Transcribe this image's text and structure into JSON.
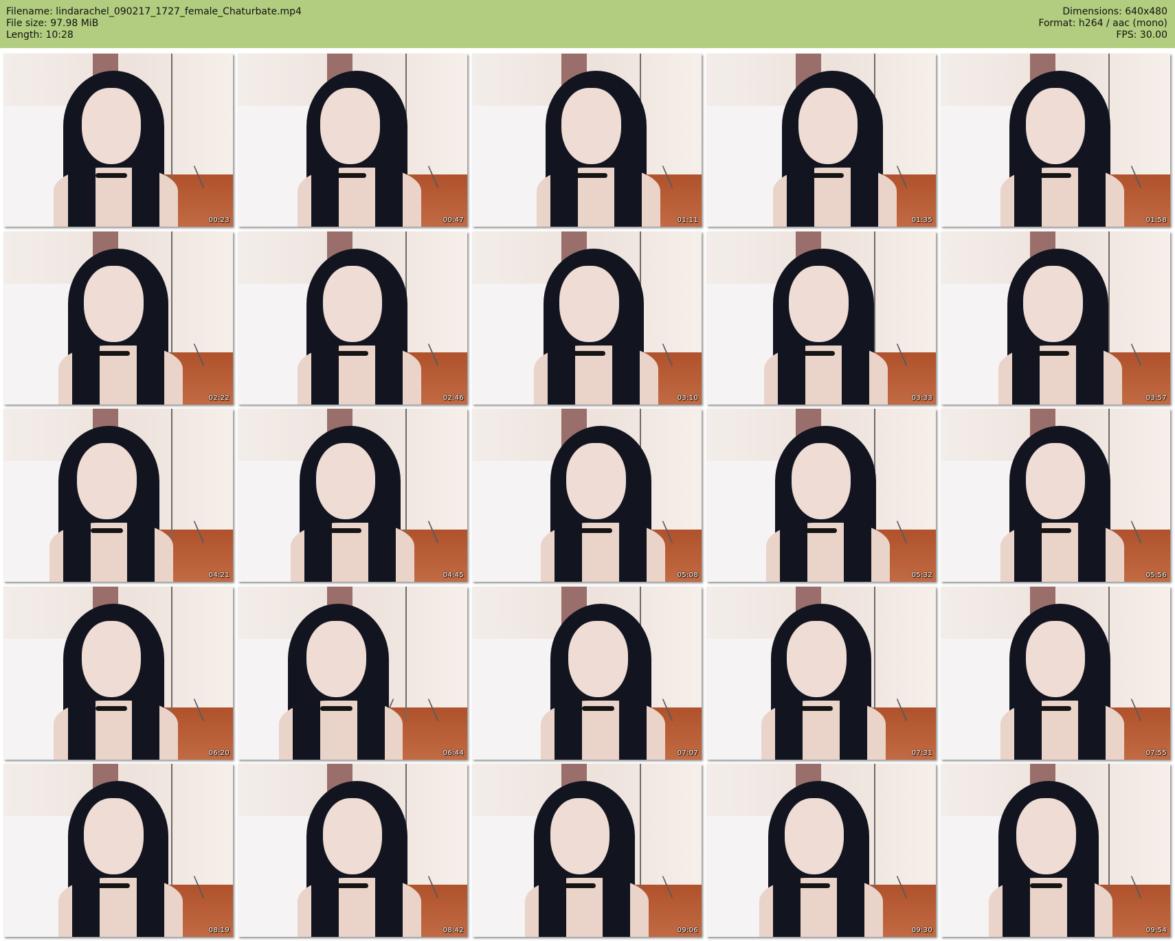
{
  "header": {
    "filename": "Filename: lindarachel_090217_1727_female_Chaturbate.mp4",
    "file_size": "File size: 97.98 MiB",
    "length": "Length: 10:28",
    "dimensions": "Dimensions: 640x480",
    "format": "Format: h264 / aac (mono)",
    "fps": "FPS: 30.00"
  },
  "colors": {
    "header_bg": "#b2cd7f",
    "background": "#ffffff"
  },
  "thumbnails": [
    "00:23",
    "00:47",
    "01:11",
    "01:35",
    "01:58",
    "02:22",
    "02:46",
    "03:10",
    "03:33",
    "03:57",
    "04:21",
    "04:45",
    "05:08",
    "05:32",
    "05:56",
    "06:20",
    "06:44",
    "07:07",
    "07:31",
    "07:55",
    "08:19",
    "08:42",
    "09:06",
    "09:30",
    "09:54"
  ]
}
